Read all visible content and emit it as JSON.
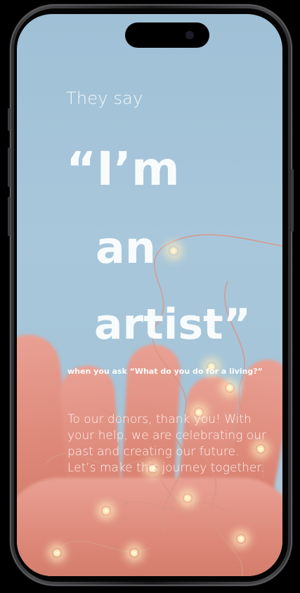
{
  "screen": {
    "intro": "They say",
    "quote_line_1": "“I’m",
    "quote_line_2": "an",
    "quote_line_3": "artist”",
    "ask_text": "when you ask “What do you do for a living?”",
    "thanks_text": "To our donors, thank you! With your help, we are celebrating our past and creating our future. Let’s make this journey together."
  },
  "colors": {
    "background_sky": "#a9c7db",
    "hand_tone": "#dd8878",
    "text": "#ffffff",
    "frame": "#2b2b2d"
  },
  "icons": {
    "camera": "front-camera-icon"
  }
}
